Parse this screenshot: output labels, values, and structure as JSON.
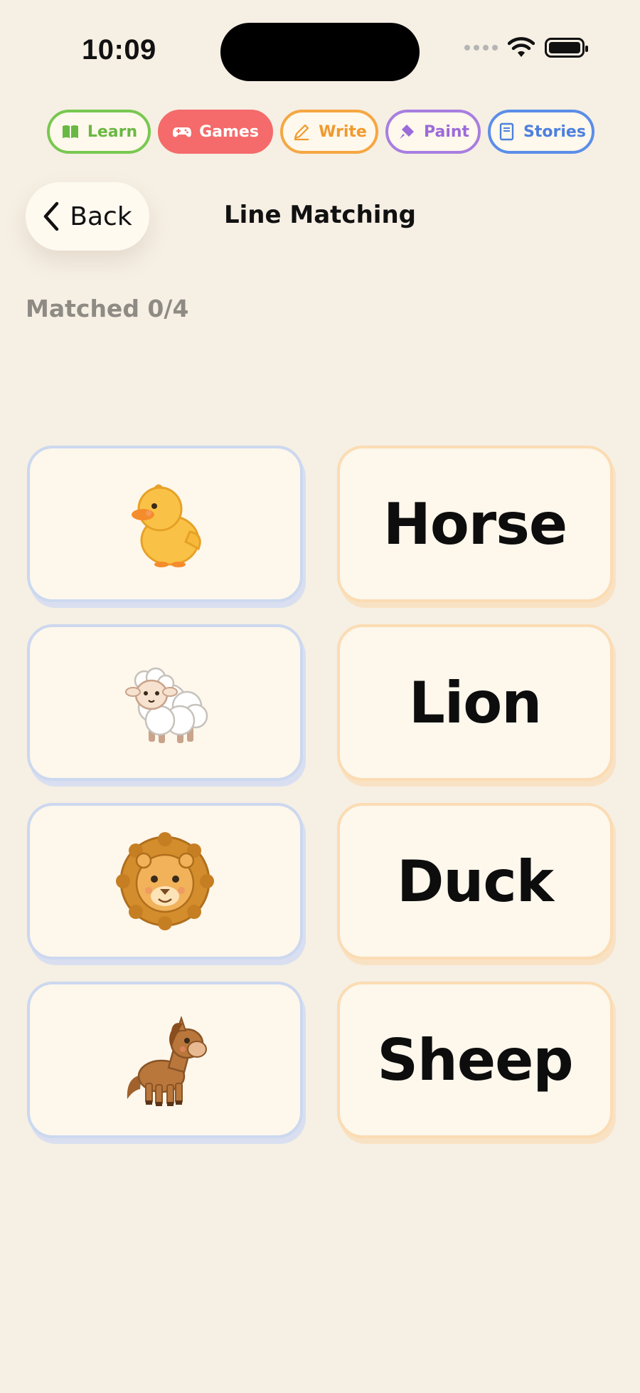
{
  "status_bar": {
    "time": "10:09"
  },
  "nav_tabs": [
    {
      "label": "Learn",
      "icon": "book-icon"
    },
    {
      "label": "Games",
      "icon": "gamepad-icon"
    },
    {
      "label": "Write",
      "icon": "pencil-icon"
    },
    {
      "label": "Paint",
      "icon": "paintbrush-icon"
    },
    {
      "label": "Stories",
      "icon": "storybook-icon"
    }
  ],
  "header": {
    "back_label": "Back",
    "title": "Line Matching"
  },
  "progress": {
    "text": "Matched 0/4",
    "matched": 0,
    "total": 4
  },
  "pictures": [
    {
      "animal": "duck",
      "icon": "duck-image"
    },
    {
      "animal": "sheep",
      "icon": "sheep-image"
    },
    {
      "animal": "lion",
      "icon": "lion-image"
    },
    {
      "animal": "horse",
      "icon": "horse-image"
    }
  ],
  "words": [
    "Horse",
    "Lion",
    "Duck",
    "Sheep"
  ],
  "colors": {
    "background": "#f6efe4",
    "learn": "#78c850",
    "games": "#f56a6a",
    "write": "#f5a742",
    "paint": "#a77ee0",
    "stories": "#5b8ee8",
    "picture_card_border": "#ccd8ef",
    "word_card_border": "#fbdcb3"
  }
}
